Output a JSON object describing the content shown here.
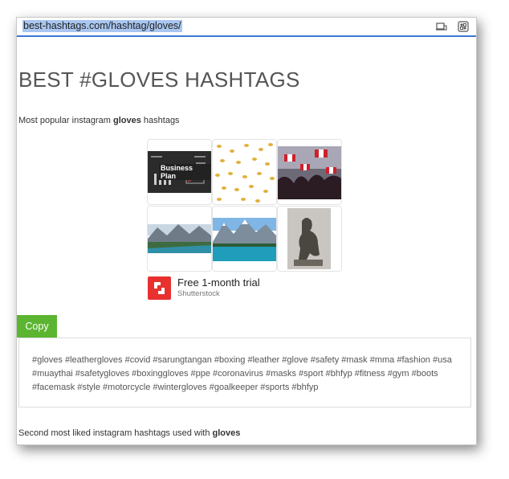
{
  "address_bar": {
    "url": "best-hashtags.com/hashtag/gloves/",
    "icons": [
      "devices-icon",
      "extensions-icon"
    ]
  },
  "page": {
    "title": "BEST #GLOVES HASHTAGS",
    "subtitle_prefix": "Most popular instagram ",
    "subtitle_bold": "gloves",
    "subtitle_suffix": " hashtags",
    "second_prefix": "Second most liked instagram hashtags used with ",
    "second_bold": "gloves"
  },
  "ad": {
    "title": "Free 1-month trial",
    "source": "Shutterstock",
    "tile_1_text": "Business Plan",
    "adchoices_label": "▷",
    "close_label": "✕"
  },
  "copy_button": {
    "label": "Copy"
  },
  "hashtags": "#gloves #leathergloves #covid #sarungtangan #boxing #leather #glove #safety #mask #mma #fashion #usa #muaythai #safetygloves #boxinggloves #ppe #coronavirus #masks #sport #bhfyp #fitness #gym #boots #facemask #style #motorcycle #wintergloves #goalkeeper #sports #bhfyp",
  "colors": {
    "accent_blue": "#3b78d6",
    "copy_green": "#5cb531",
    "shutterstock_red": "#e8312f"
  }
}
